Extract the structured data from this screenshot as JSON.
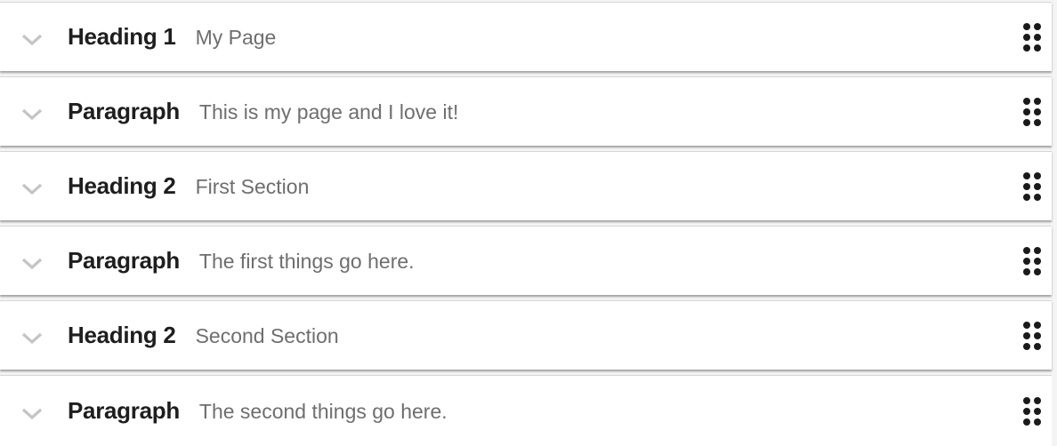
{
  "blocks": [
    {
      "type": "Heading 1",
      "preview": "My Page",
      "expand_icon": "chevron-down-icon",
      "drag_icon": "drag-handle-icon"
    },
    {
      "type": "Paragraph",
      "preview": "This is my page and I love it!",
      "expand_icon": "chevron-down-icon",
      "drag_icon": "drag-handle-icon"
    },
    {
      "type": "Heading 2",
      "preview": "First Section",
      "expand_icon": "chevron-down-icon",
      "drag_icon": "drag-handle-icon"
    },
    {
      "type": "Paragraph",
      "preview": "The first things go here.",
      "expand_icon": "chevron-down-icon",
      "drag_icon": "drag-handle-icon"
    },
    {
      "type": "Heading 2",
      "preview": "Second Section",
      "expand_icon": "chevron-down-icon",
      "drag_icon": "drag-handle-icon"
    },
    {
      "type": "Paragraph",
      "preview": "The second things go here.",
      "expand_icon": "chevron-down-icon",
      "drag_icon": "drag-handle-icon"
    }
  ],
  "colors": {
    "chevron": "#c4c4c4",
    "type_label": "#1e1e1e",
    "preview_text": "#6e6e6e",
    "drag_dots": "#1a1a1a",
    "row_background": "#ffffff"
  }
}
